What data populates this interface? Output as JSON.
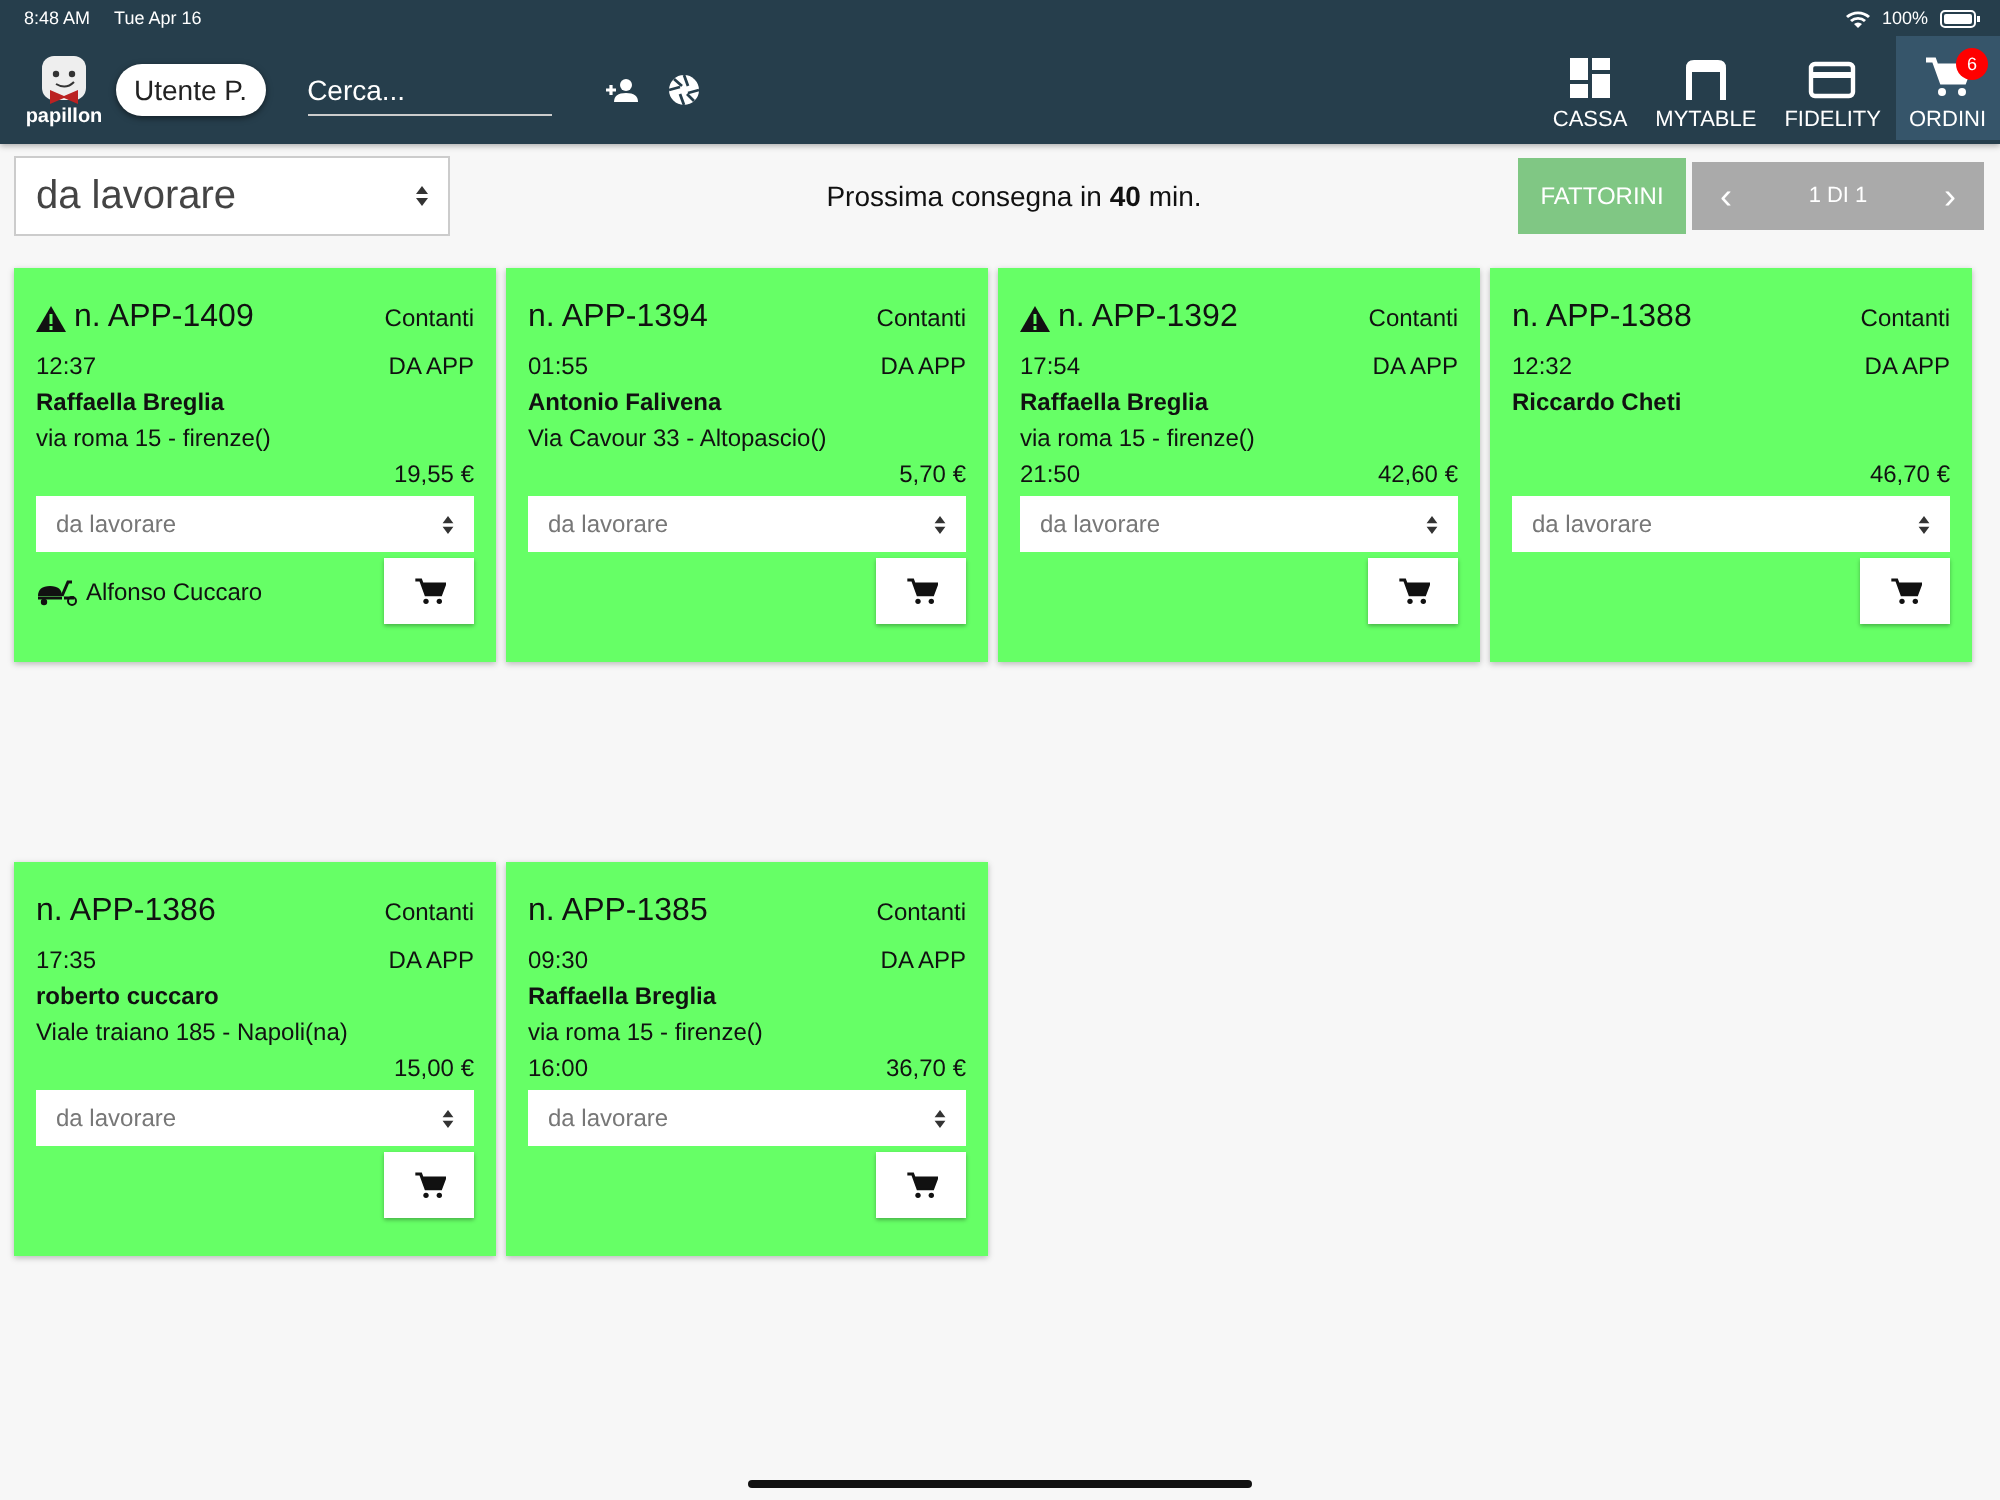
{
  "status_bar": {
    "time": "8:48 AM",
    "date": "Tue Apr 16",
    "battery": "100%"
  },
  "app_bar": {
    "logo_text": "papillon",
    "user": "Utente P.",
    "search": {
      "placeholder": "Cerca..."
    },
    "nav": [
      {
        "kind": "cassa",
        "label": "CASSA",
        "selected": false
      },
      {
        "kind": "table",
        "label": "MYTABLE",
        "selected": false
      },
      {
        "kind": "card",
        "label": "FIDELITY",
        "selected": false
      },
      {
        "kind": "cart",
        "label": "ORDINI",
        "selected": true,
        "badge": "6"
      }
    ]
  },
  "toolbar": {
    "filter": "da lavorare",
    "next_delivery": "Prossima consegna in **40** min.",
    "riders_button": "FATTORINI",
    "pager": {
      "prev": "‹",
      "label": "1 DI 1",
      "next": "›",
      "disabled": true
    }
  },
  "orders": [
    {
      "warning": true,
      "number": "n. APP-1409",
      "payment": "Contanti",
      "time": "12:37",
      "source": "DA APP",
      "customer": "Raffaella Breglia",
      "address": "via roma 15 -  firenze()",
      "total": "19,55 €",
      "status": "da lavorare",
      "rider": "Alfonso Cuccaro"
    },
    {
      "warning": false,
      "number": "n. APP-1394",
      "payment": "Contanti",
      "time": "01:55",
      "source": "DA APP",
      "customer": "Antonio Falivena",
      "address": "Via Cavour 33 -  Altopascio()",
      "total": "5,70 €",
      "status": "da lavorare"
    },
    {
      "warning": true,
      "number": "n. APP-1392",
      "payment": "Contanti",
      "time": "17:54",
      "source": "DA APP",
      "customer": "Raffaella Breglia",
      "address": "via roma 15 -  firenze()",
      "delivery_time": "21:50",
      "total": "42,60 €",
      "status": "da lavorare"
    },
    {
      "warning": false,
      "number": "n. APP-1388",
      "payment": "Contanti",
      "time": "12:32",
      "source": "DA APP",
      "customer": "Riccardo Cheti",
      "total": "46,70 €",
      "status": "da lavorare"
    },
    {
      "warning": false,
      "number": "n. APP-1386",
      "payment": "Contanti",
      "time": "17:35",
      "source": "DA APP",
      "customer": "roberto cuccaro",
      "address": "Viale traiano 185 -  Napoli(na)",
      "total": "15,00 €",
      "status": "da lavorare"
    },
    {
      "warning": false,
      "number": "n. APP-1385",
      "payment": "Contanti",
      "time": "09:30",
      "source": "DA APP",
      "customer": "Raffaella Breglia",
      "address": "via roma 15 -  firenze()",
      "delivery_time": "16:00",
      "total": "36,70 €",
      "status": "da lavorare"
    }
  ]
}
